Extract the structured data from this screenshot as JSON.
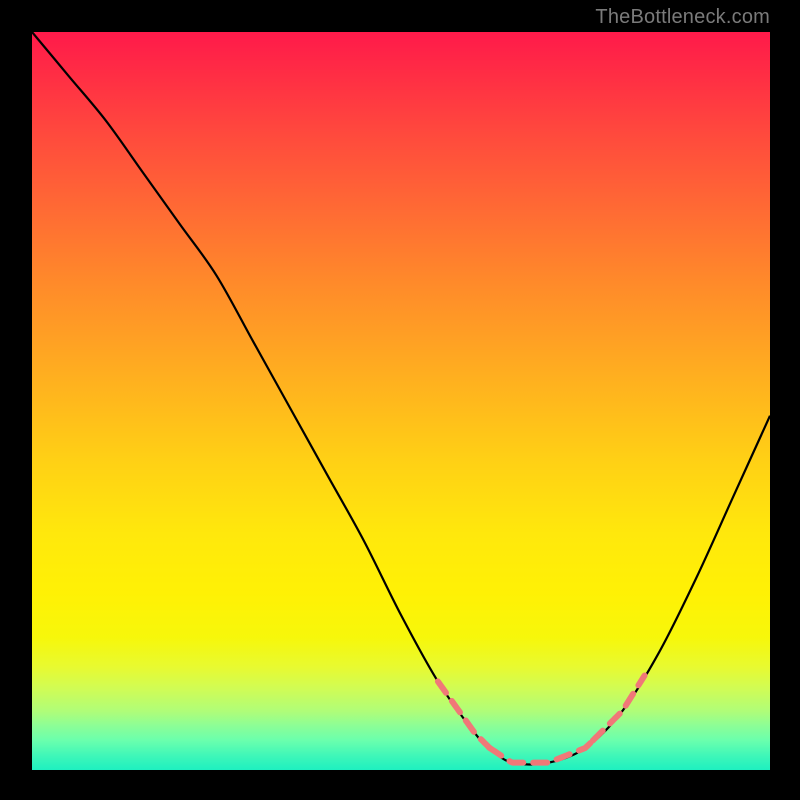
{
  "watermark": {
    "text": "TheBottleneck.com"
  },
  "colors": {
    "curve_stroke": "#000000",
    "dash_stroke": "#f07878",
    "background_black": "#000000"
  },
  "chart_data": {
    "type": "line",
    "title": "",
    "xlabel": "",
    "ylabel": "",
    "xlim": [
      0,
      100
    ],
    "ylim": [
      0,
      100
    ],
    "series": [
      {
        "name": "bottleneck-curve",
        "x": [
          0,
          5,
          10,
          15,
          20,
          25,
          30,
          35,
          40,
          45,
          50,
          55,
          60,
          62,
          65,
          70,
          75,
          80,
          85,
          90,
          95,
          100
        ],
        "y": [
          100,
          94,
          88,
          81,
          74,
          67,
          58,
          49,
          40,
          31,
          21,
          12,
          5,
          3,
          1,
          1,
          3,
          8,
          16,
          26,
          37,
          48
        ]
      }
    ],
    "annotations": [
      {
        "name": "left-dash-segment",
        "x_range": [
          55,
          62
        ],
        "style": "dashed"
      },
      {
        "name": "right-dash-segment",
        "x_range": [
          76,
          83
        ],
        "style": "dashed"
      }
    ]
  }
}
